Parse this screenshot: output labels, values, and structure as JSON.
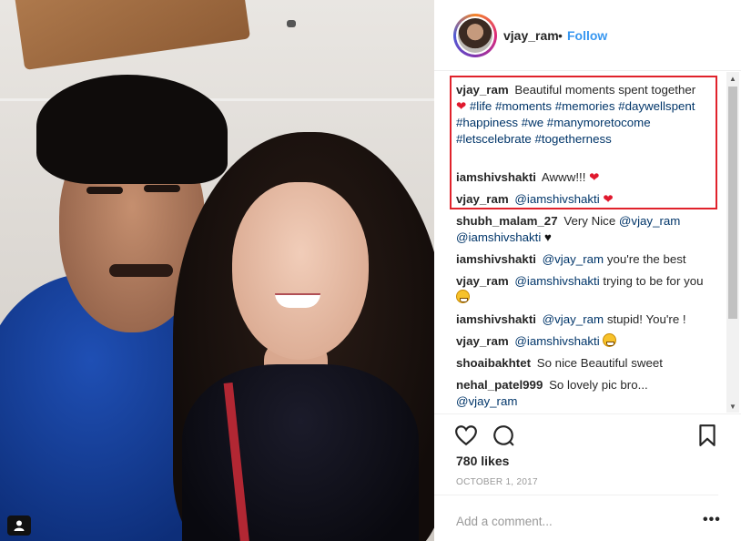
{
  "post": {
    "username": "vjay_ram",
    "separator": "•",
    "follow_label": "Follow",
    "likes": "780 likes",
    "date": "OCTOBER 1, 2017",
    "add_comment_placeholder": "Add a comment...",
    "more_label": "•••"
  },
  "caption": {
    "user": "vjay_ram",
    "text_before": "Beautiful moments spent together",
    "heart": "❤",
    "tags": "#life #moments #memories #daywellspent #happiness #we #manymoretocome #letscelebrate #togetherness"
  },
  "comments": [
    {
      "user": "iamshivshakti",
      "text": "Awww!!!",
      "emoji": "❤"
    },
    {
      "user": "vjay_ram",
      "mention": "@iamshivshakti",
      "emoji": "❤"
    },
    {
      "user": "shubh_malam_27",
      "text": "Very Nice",
      "mention": "@vjay_ram @iamshivshakti",
      "emoji": "♥"
    },
    {
      "user": "iamshivshakti",
      "mention": "@vjay_ram",
      "text": "you're the best"
    },
    {
      "user": "vjay_ram",
      "mention": "@iamshivshakti",
      "text": "trying to be for you",
      "emoji": "grinning-face"
    },
    {
      "user": "iamshivshakti",
      "mention": "@vjay_ram",
      "text": "stupid! You're !"
    },
    {
      "user": "vjay_ram",
      "mention": "@iamshivshakti",
      "emoji": "hugging-face"
    },
    {
      "user": "shoaibakhtet",
      "text": "So nice Beautiful sweet"
    },
    {
      "user": "nehal_patel999",
      "text": "So lovely pic bro...",
      "mention": "@vjay_ram"
    }
  ],
  "icons": {
    "like": "heart-outline-icon",
    "comment": "comment-bubble-icon",
    "save": "bookmark-icon",
    "photo_user": "user-tag-icon"
  },
  "colors": {
    "link": "#3897f0",
    "tag": "#003569",
    "highlight": "#e0222b",
    "heart": "#e0182d"
  }
}
